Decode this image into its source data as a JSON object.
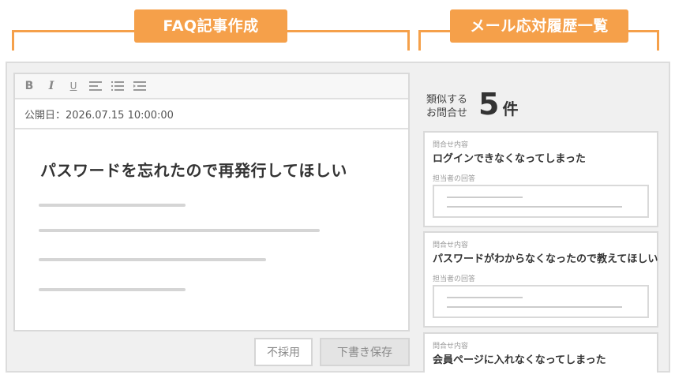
{
  "headers": {
    "left_label": "FAQ記事作成",
    "right_label": "メール応対履歴一覧"
  },
  "accent_color": "#f5a04a",
  "editor": {
    "toolbar": {
      "bold": "B",
      "italic": "I",
      "underline": "U",
      "align_icon": "align-left-icon",
      "list_icon": "list-icon",
      "indent_icon": "indent-icon"
    },
    "publish_date": "公開日：2026.07.15 10:00:00",
    "article_title": "パスワードを忘れたので再発行してほしい"
  },
  "actions": {
    "reject_label": "不採用",
    "draft_label": "下書き保存"
  },
  "similar": {
    "label": "類似する お問合せ",
    "count": "5",
    "unit": "件"
  },
  "inquiries": [
    {
      "question_label": "問合せ内容",
      "question": "ログインできなくなってしまった",
      "answer_label": "担当者の回答"
    },
    {
      "question_label": "問合せ内容",
      "question": "パスワードがわからなくなったので教えてほしい",
      "answer_label": "担当者の回答"
    },
    {
      "question_label": "問合せ内容",
      "question": "会員ページに入れなくなってしまった"
    }
  ]
}
